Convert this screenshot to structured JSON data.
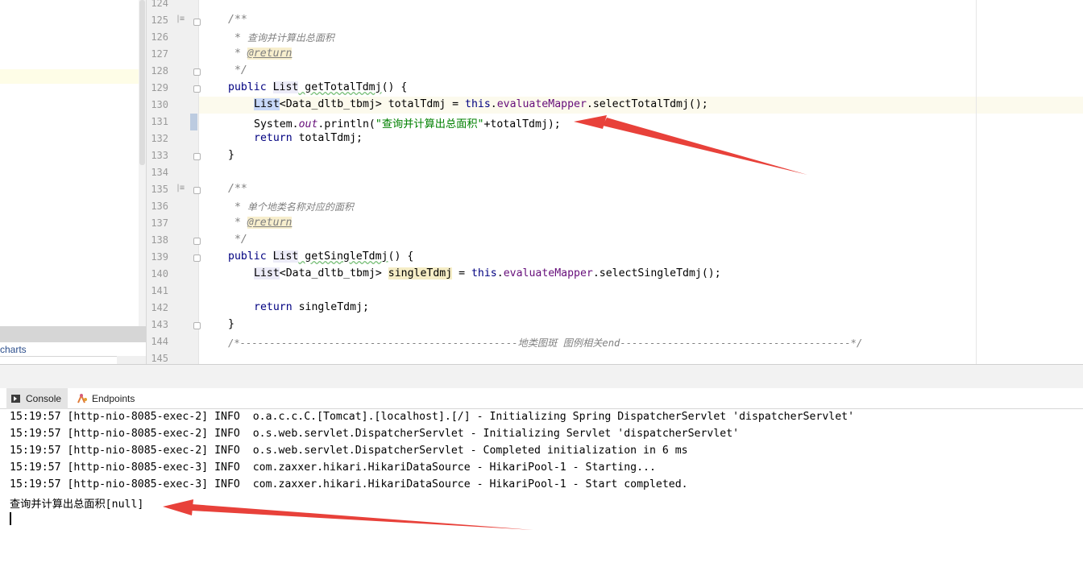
{
  "project_panel": {
    "charts_label": "charts"
  },
  "editor": {
    "line_numbers": [
      "124",
      "125",
      "126",
      "127",
      "128",
      "129",
      "130",
      "131",
      "132",
      "133",
      "134",
      "135",
      "136",
      "137",
      "138",
      "139",
      "140",
      "141",
      "142",
      "143",
      "144",
      "145"
    ],
    "code": {
      "l125": "/**",
      "l126_star": " * ",
      "l126_text": "查询并计算出总面积",
      "l127_star": " * ",
      "l127_tag": "@return",
      "l128": " */",
      "l129_kw": "public ",
      "l129_type": "List",
      "l129_name": " getTotalTdmj",
      "l129_rest": "() {",
      "l130_type": "List",
      "l130_a": "<Data_dltb_tbmj> totalTdmj = ",
      "l130_this": "this",
      "l130_dot": ".",
      "l130_field": "evaluateMapper",
      "l130_call": ".selectTotalTdmj();",
      "l131_a": "System.",
      "l131_out": "out",
      "l131_b": ".println(",
      "l131_str": "\"查询并计算出总面积\"",
      "l131_c": "+totalTdmj);",
      "l132_kw": "return",
      "l132_rest": " totalTdmj;",
      "l133": "}",
      "l135": "/**",
      "l136_star": " * ",
      "l136_text": "单个地类名称对应的面积",
      "l137_star": " * ",
      "l137_tag": "@return",
      "l138": " */",
      "l139_kw": "public ",
      "l139_type": "List",
      "l139_name": " getSingleTdmj",
      "l139_rest": "() {",
      "l140_type": "List",
      "l140_a": "<Data_dltb_tbmj> ",
      "l140_var": "singleTdmj",
      "l140_b": " = ",
      "l140_this": "this",
      "l140_dot": ".",
      "l140_field": "evaluateMapper",
      "l140_call": ".selectSingleTdmj();",
      "l142_kw": "return",
      "l142_rest": " singleTdmj;",
      "l143": "}",
      "l144": "/*-----------------------------------------------地类图斑 图例相关end---------------------------------------*/"
    }
  },
  "tool_window": {
    "tabs": {
      "console": "Console",
      "endpoints": "Endpoints"
    },
    "console_lines": [
      "15:19:57 [http-nio-8085-exec-2] INFO  o.a.c.c.C.[Tomcat].[localhost].[/] - Initializing Spring DispatcherServlet 'dispatcherServlet'",
      "15:19:57 [http-nio-8085-exec-2] INFO  o.s.web.servlet.DispatcherServlet - Initializing Servlet 'dispatcherServlet'",
      "15:19:57 [http-nio-8085-exec-2] INFO  o.s.web.servlet.DispatcherServlet - Completed initialization in 6 ms",
      "15:19:57 [http-nio-8085-exec-3] INFO  com.zaxxer.hikari.HikariDataSource - HikariPool-1 - Starting...",
      "15:19:57 [http-nio-8085-exec-3] INFO  com.zaxxer.hikari.HikariDataSource - HikariPool-1 - Start completed.",
      "查询并计算出总面积[null]"
    ]
  },
  "colors": {
    "arrow": "#e8413a",
    "keyword": "#000080",
    "string": "#008000",
    "field": "#660e7a",
    "comment": "#808080"
  }
}
